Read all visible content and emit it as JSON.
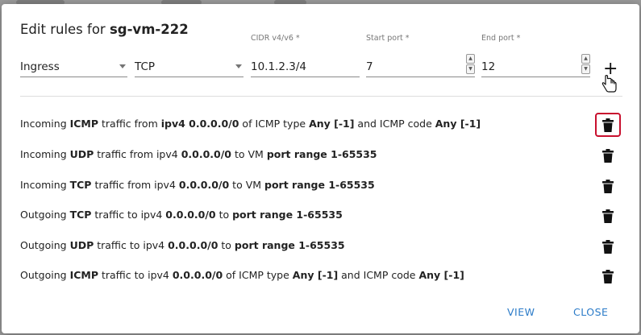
{
  "dialog": {
    "title_prefix": "Edit rules for",
    "title_name": "sg-vm-222"
  },
  "form": {
    "direction": {
      "value": "Ingress"
    },
    "protocol": {
      "value": "TCP"
    },
    "cidr": {
      "label": "CIDR v4/v6 *",
      "value": "10.1.2.3/4"
    },
    "start_port": {
      "label": "Start port *",
      "value": "7"
    },
    "end_port": {
      "label": "End port *",
      "value": "12"
    },
    "add_icon": "plus-icon"
  },
  "rules": [
    {
      "parts": [
        [
          "Incoming ",
          false
        ],
        [
          "ICMP",
          true
        ],
        [
          " traffic from ",
          false
        ],
        [
          "ipv4 0.0.0.0/0",
          true
        ],
        [
          " of ICMP type ",
          false
        ],
        [
          "Any [-1]",
          true
        ],
        [
          " and ICMP code ",
          false
        ],
        [
          "Any [-1]",
          true
        ]
      ],
      "highlighted": true
    },
    {
      "parts": [
        [
          "Incoming ",
          false
        ],
        [
          "UDP",
          true
        ],
        [
          " traffic from ipv4 ",
          false
        ],
        [
          "0.0.0.0/0",
          true
        ],
        [
          " to VM ",
          false
        ],
        [
          "port range 1-65535",
          true
        ]
      ],
      "highlighted": false
    },
    {
      "parts": [
        [
          "Incoming ",
          false
        ],
        [
          "TCP",
          true
        ],
        [
          " traffic from ipv4 ",
          false
        ],
        [
          "0.0.0.0/0",
          true
        ],
        [
          " to VM ",
          false
        ],
        [
          "port range 1-65535",
          true
        ]
      ],
      "highlighted": false
    },
    {
      "parts": [
        [
          "Outgoing ",
          false
        ],
        [
          "TCP",
          true
        ],
        [
          " traffic to ipv4 ",
          false
        ],
        [
          "0.0.0.0/0",
          true
        ],
        [
          " to ",
          false
        ],
        [
          "port range 1-65535",
          true
        ]
      ],
      "highlighted": false
    },
    {
      "parts": [
        [
          "Outgoing ",
          false
        ],
        [
          "UDP",
          true
        ],
        [
          " traffic to ipv4 ",
          false
        ],
        [
          "0.0.0.0/0",
          true
        ],
        [
          " to ",
          false
        ],
        [
          "port range 1-65535",
          true
        ]
      ],
      "highlighted": false
    },
    {
      "parts": [
        [
          "Outgoing ",
          false
        ],
        [
          "ICMP",
          true
        ],
        [
          " traffic to ipv4 ",
          false
        ],
        [
          "0.0.0.0/0",
          true
        ],
        [
          " of ICMP type ",
          false
        ],
        [
          "Any [-1]",
          true
        ],
        [
          " and ICMP code ",
          false
        ],
        [
          "Any [-1]",
          true
        ]
      ],
      "highlighted": false
    }
  ],
  "footer": {
    "view_label": "VIEW",
    "close_label": "CLOSE"
  },
  "colors": {
    "accent": "#2b7bc8",
    "highlight": "#c8102e"
  }
}
